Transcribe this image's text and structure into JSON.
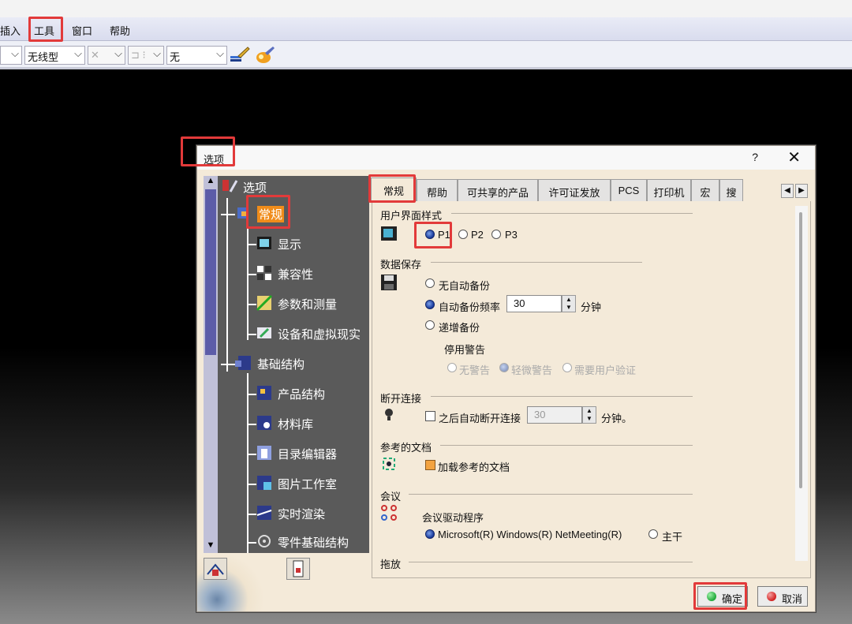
{
  "menubar": {
    "items": [
      "插入",
      "工具",
      "窗口",
      "帮助"
    ]
  },
  "toolbar": {
    "combo_a": "",
    "line_type": "无线型",
    "combo_x": "✕",
    "combo_c": "⊐ ⁝",
    "combo_none": "无"
  },
  "dialog": {
    "title": "选项",
    "help": "?",
    "close": "✕",
    "ok": "确定",
    "cancel": "取消",
    "tree": {
      "root": "选项",
      "nodes": [
        "常规",
        "显示",
        "兼容性",
        "参数和测量",
        "设备和虚拟现实",
        "基础结构",
        "产品结构",
        "材料库",
        "目录编辑器",
        "图片工作室",
        "实时渲染",
        "零件基础结构"
      ]
    },
    "tabs": [
      "常规",
      "帮助",
      "可共享的产品",
      "许可证发放",
      "PCS",
      "打印机",
      "宏",
      "搜"
    ],
    "content": {
      "ui_style": {
        "title": "用户界面样式",
        "options": [
          "P1",
          "P2",
          "P3"
        ],
        "selected": "P1"
      },
      "data_save": {
        "title": "数据保存",
        "no_backup": "无自动备份",
        "auto_backup": "自动备份频率",
        "auto_value": "30",
        "minutes": "分钟",
        "incremental": "递增备份",
        "warning_title": "停用警告",
        "warnings": [
          "无警告",
          "轻微警告",
          "需要用户验证"
        ]
      },
      "disconnect": {
        "title": "断开连接",
        "label": "之后自动断开连接",
        "value": "30",
        "minutes": "分钟。"
      },
      "ref_docs": {
        "title": "参考的文档",
        "label": "加载参考的文档"
      },
      "meeting": {
        "title": "会议",
        "driver": "会议驱动程序",
        "option1": "Microsoft(R) Windows(R) NetMeeting(R)",
        "option2": "主干"
      },
      "drag": {
        "title": "拖放"
      }
    }
  },
  "colors": {
    "highlight": "#e23a3a",
    "selected_tree": "#f08c1a",
    "ok_dot": "#1fa83a",
    "cancel_dot": "#d22020"
  }
}
